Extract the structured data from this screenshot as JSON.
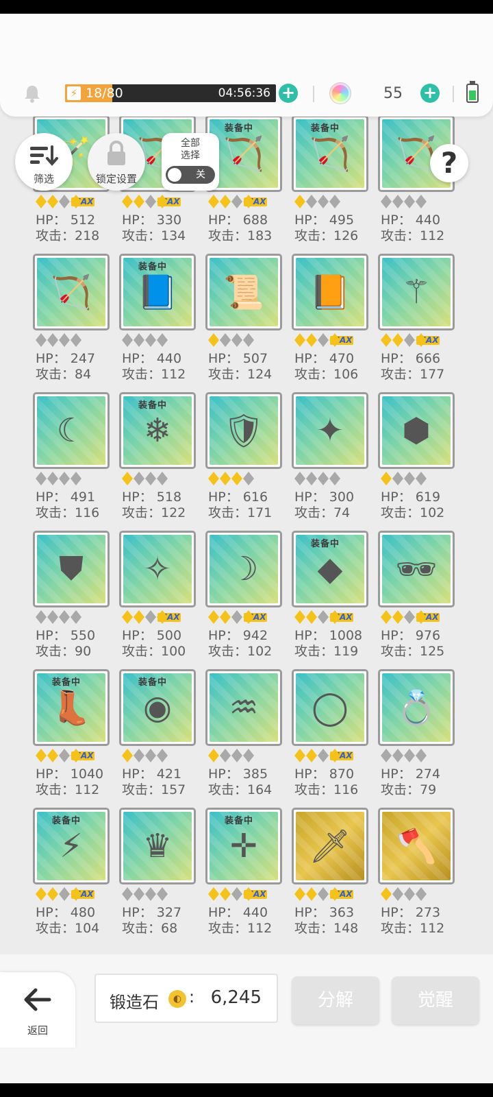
{
  "header": {
    "energy_count": "18/80",
    "energy_fraction": 0.225,
    "energy_timer": "04:56:36",
    "gem_count": "55",
    "icons": [
      "bell-icon",
      "lightning-icon",
      "plus-icon",
      "rainbow-orb-icon",
      "battery-icon"
    ]
  },
  "controls": {
    "filter_label": "筛选",
    "lock_label": "锁定设置",
    "select_all_line1": "全部",
    "select_all_line2": "选择",
    "toggle_state": "关",
    "help_symbol": "?"
  },
  "equipped_tag": "装备中",
  "max_tag": "MAX",
  "items": [
    {
      "hp": "HP： 512",
      "atk": "攻击：218",
      "stars": 2,
      "max": true,
      "equipped": false,
      "icon": "staff-icon",
      "bg": "teal"
    },
    {
      "hp": "HP： 330",
      "atk": "攻击：134",
      "stars": 2,
      "max": true,
      "equipped": false,
      "icon": "crossbow-icon",
      "bg": "teal"
    },
    {
      "hp": "HP： 688",
      "atk": "攻击：183",
      "stars": 2,
      "max": true,
      "equipped": true,
      "icon": "bow-icon",
      "bg": "teal"
    },
    {
      "hp": "HP： 495",
      "atk": "攻击：126",
      "stars": 1,
      "max": false,
      "equipped": true,
      "icon": "dark-bow-icon",
      "bg": "teal"
    },
    {
      "hp": "HP： 440",
      "atk": "攻击：112",
      "stars": 0,
      "max": false,
      "equipped": false,
      "icon": "dark-bow-icon",
      "bg": "teal"
    },
    {
      "hp": "HP： 247",
      "atk": "攻击：84",
      "stars": 0,
      "max": false,
      "equipped": false,
      "icon": "golden-bow-icon",
      "bg": "teal"
    },
    {
      "hp": "HP： 440",
      "atk": "攻击：112",
      "stars": 0,
      "max": false,
      "equipped": true,
      "icon": "spellbook-icon",
      "bg": "teal"
    },
    {
      "hp": "HP： 507",
      "atk": "攻击：124",
      "stars": 1,
      "max": false,
      "equipped": false,
      "icon": "scroll-icon",
      "bg": "teal"
    },
    {
      "hp": "HP： 470",
      "atk": "攻击：106",
      "stars": 2,
      "max": true,
      "equipped": false,
      "icon": "tome-icon",
      "bg": "teal"
    },
    {
      "hp": "HP： 666",
      "atk": "攻击：177",
      "stars": 2,
      "max": true,
      "equipped": false,
      "icon": "scepter-icon",
      "bg": "teal"
    },
    {
      "hp": "HP： 491",
      "atk": "攻击：116",
      "stars": 0,
      "max": false,
      "equipped": false,
      "icon": "scythe-icon",
      "bg": "teal"
    },
    {
      "hp": "HP： 518",
      "atk": "攻击：122",
      "stars": 1,
      "max": false,
      "equipped": true,
      "icon": "ice-staff-icon",
      "bg": "teal"
    },
    {
      "hp": "HP： 616",
      "atk": "攻击：171",
      "stars": 3,
      "max": false,
      "equipped": false,
      "icon": "rune-shield-icon",
      "bg": "teal"
    },
    {
      "hp": "HP： 300",
      "atk": "攻击：74",
      "stars": 0,
      "max": false,
      "equipped": false,
      "icon": "gem-crossbow-icon",
      "bg": "teal"
    },
    {
      "hp": "HP： 619",
      "atk": "攻击：102",
      "stars": 1,
      "max": false,
      "equipped": false,
      "icon": "dark-shield-icon",
      "bg": "teal"
    },
    {
      "hp": "HP： 550",
      "atk": "攻击：90",
      "stars": 0,
      "max": false,
      "equipped": false,
      "icon": "tower-shield-icon",
      "bg": "teal"
    },
    {
      "hp": "HP： 500",
      "atk": "攻击：100",
      "stars": 2,
      "max": true,
      "equipped": false,
      "icon": "winged-shield-icon",
      "bg": "teal"
    },
    {
      "hp": "HP： 942",
      "atk": "攻击：102",
      "stars": 2,
      "max": true,
      "equipped": false,
      "icon": "tooth-necklace-icon",
      "bg": "teal"
    },
    {
      "hp": "HP： 1008",
      "atk": "攻击：119",
      "stars": 2,
      "max": true,
      "equipped": true,
      "icon": "crystal-icon",
      "bg": "teal"
    },
    {
      "hp": "HP： 976",
      "atk": "攻击：125",
      "stars": 2,
      "max": true,
      "equipped": false,
      "icon": "sunglasses-icon",
      "bg": "teal"
    },
    {
      "hp": "HP： 1040",
      "atk": "攻击：112",
      "stars": 2,
      "max": true,
      "equipped": true,
      "icon": "boot-icon",
      "bg": "teal"
    },
    {
      "hp": "HP： 421",
      "atk": "攻击：157",
      "stars": 1,
      "max": false,
      "equipped": true,
      "icon": "orb-disc-icon",
      "bg": "teal"
    },
    {
      "hp": "HP： 385",
      "atk": "攻击：164",
      "stars": 1,
      "max": false,
      "equipped": false,
      "icon": "pendant-icon",
      "bg": "teal"
    },
    {
      "hp": "HP： 870",
      "atk": "攻击：116",
      "stars": 2,
      "max": true,
      "equipped": false,
      "icon": "bracelet-icon",
      "bg": "teal"
    },
    {
      "hp": "HP： 274",
      "atk": "攻击：79",
      "stars": 0,
      "max": false,
      "equipped": false,
      "icon": "gem-ring-icon",
      "bg": "teal"
    },
    {
      "hp": "HP： 480",
      "atk": "攻击：104",
      "stars": 2,
      "max": true,
      "equipped": true,
      "icon": "belt-icon",
      "bg": "teal"
    },
    {
      "hp": "HP： 327",
      "atk": "攻击：68",
      "stars": 0,
      "max": false,
      "equipped": false,
      "icon": "tiara-icon",
      "bg": "teal"
    },
    {
      "hp": "HP： 440",
      "atk": "攻击：112",
      "stars": 2,
      "max": true,
      "equipped": true,
      "icon": "rifle-icon",
      "bg": "teal"
    },
    {
      "hp": "HP： 363",
      "atk": "攻击：148",
      "stars": 2,
      "max": true,
      "equipped": false,
      "icon": "sword-icon",
      "bg": "gold"
    },
    {
      "hp": "HP： 273",
      "atk": "攻击：112",
      "stars": 1,
      "max": false,
      "equipped": false,
      "icon": "axe-icon",
      "bg": "gold"
    }
  ],
  "footer": {
    "back_label": "返回",
    "forge_label": "锻造石",
    "forge_colon": ":",
    "forge_value": "6,245",
    "decompose_label": "分解",
    "awaken_label": "觉醒"
  }
}
